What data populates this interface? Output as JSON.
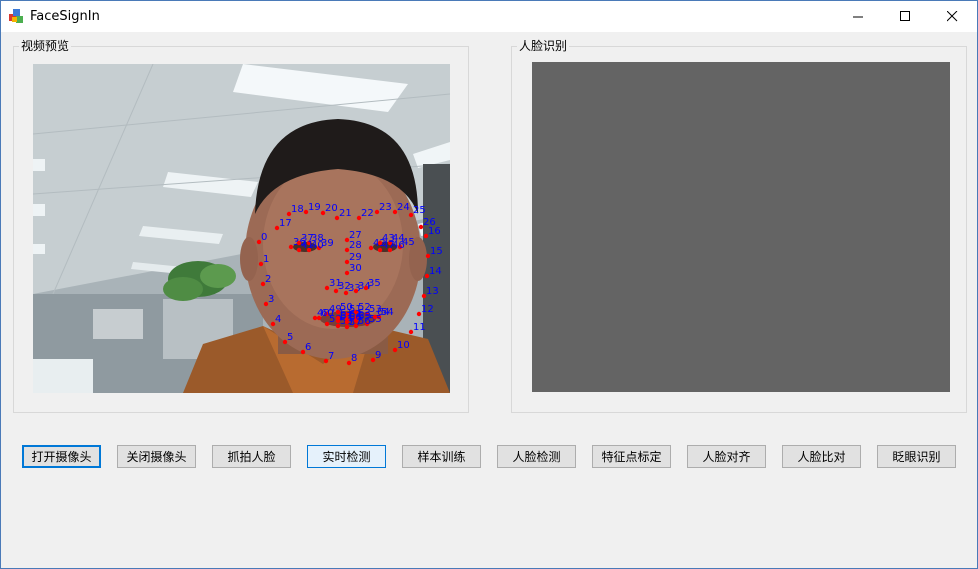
{
  "window": {
    "title": "FaceSignIn"
  },
  "groups": {
    "video": {
      "label": "视频预览"
    },
    "face": {
      "label": "人脸识别"
    }
  },
  "landmarks": [
    "0",
    "1",
    "2",
    "3",
    "4",
    "5",
    "6",
    "7",
    "8",
    "9",
    "10",
    "11",
    "12",
    "13",
    "14",
    "15",
    "16",
    "17",
    "18",
    "19",
    "20",
    "21",
    "22",
    "23",
    "24",
    "25",
    "26",
    "27",
    "28",
    "29",
    "30",
    "31",
    "32",
    "33",
    "34",
    "35",
    "36",
    "37",
    "38",
    "39",
    "40",
    "41",
    "42",
    "43",
    "44",
    "45",
    "46",
    "47",
    "48",
    "49",
    "50",
    "51",
    "52",
    "53",
    "54",
    "55",
    "56",
    "57",
    "58",
    "59",
    "60",
    "61",
    "62",
    "63",
    "64",
    "65",
    "66",
    "67"
  ],
  "buttons": [
    {
      "label": "打开摄像头"
    },
    {
      "label": "关闭摄像头"
    },
    {
      "label": "抓拍人脸"
    },
    {
      "label": "实时检测"
    },
    {
      "label": "样本训练"
    },
    {
      "label": "人脸检测"
    },
    {
      "label": "特征点标定"
    },
    {
      "label": "人脸对齐"
    },
    {
      "label": "人脸比对"
    },
    {
      "label": "眨眼识别"
    }
  ],
  "colors": {
    "accent": "#0078d7",
    "landmark_dot": "#ff0000",
    "landmark_label": "#0000ff",
    "panel": "#646464"
  }
}
